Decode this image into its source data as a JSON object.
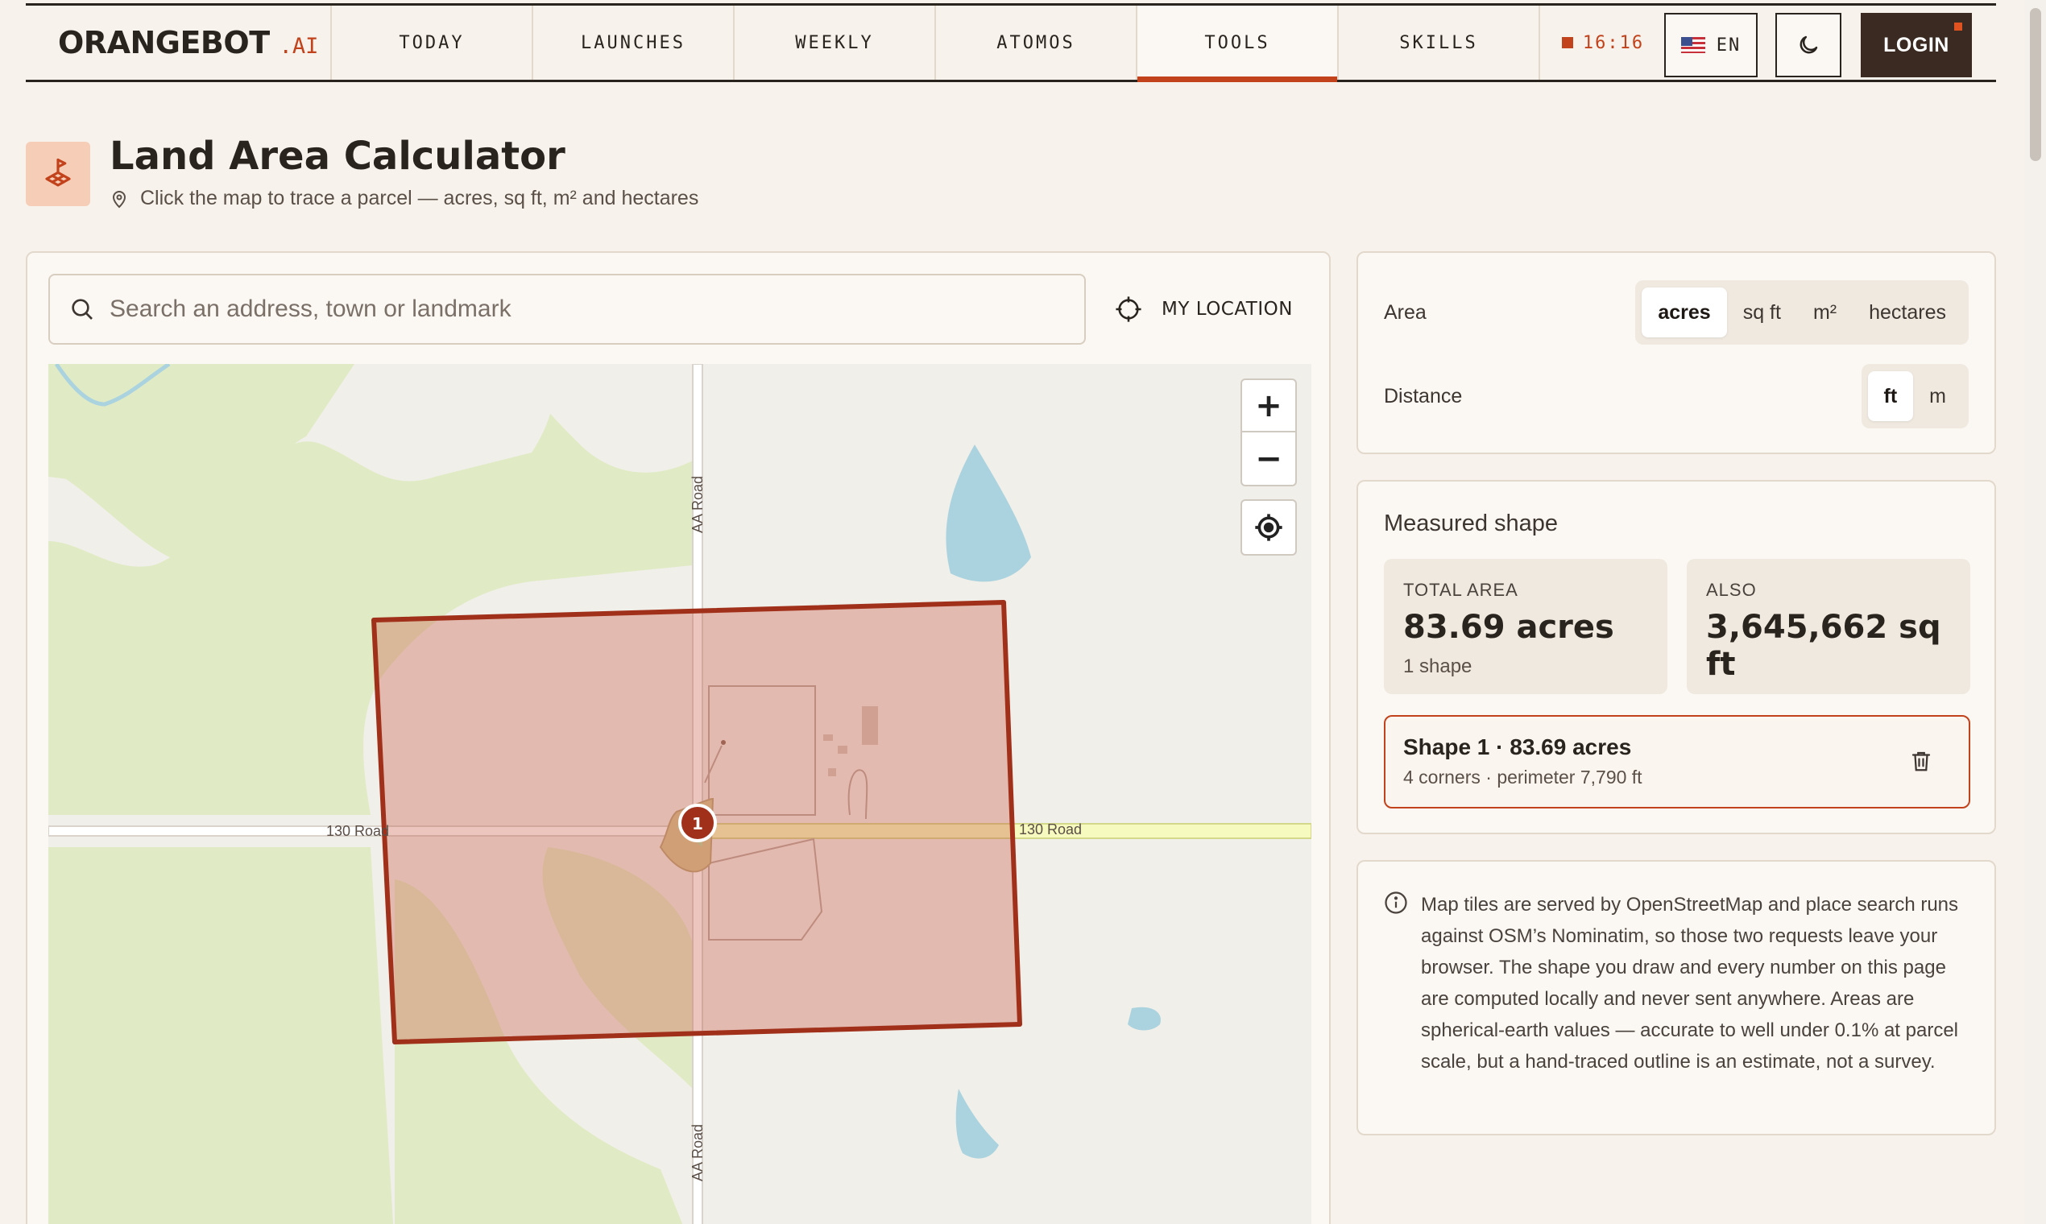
{
  "brand": {
    "name": "ORANGEBOT",
    "suffix": ".AI"
  },
  "nav": {
    "tabs": [
      "TODAY",
      "LAUNCHES",
      "WEEKLY",
      "ATOMOS",
      "TOOLS",
      "SKILLS"
    ],
    "active_tab": "TOOLS",
    "clock": "16:16",
    "language": "EN",
    "login": "LOGIN"
  },
  "header": {
    "title": "Land Area Calculator",
    "subtitle": "Click the map to trace a parcel — acres, sq ft, m² and hectares"
  },
  "search": {
    "placeholder": "Search an address, town or landmark",
    "my_location": "MY LOCATION"
  },
  "map": {
    "road_labels": [
      "AA Road",
      "130 Road",
      "130 Road",
      "AA Road"
    ],
    "vertex_label": "1",
    "zoom_in": "+",
    "zoom_out": "−"
  },
  "units": {
    "area_label": "Area",
    "area_options": [
      "acres",
      "sq ft",
      "m²",
      "hectares"
    ],
    "area_selected": "acres",
    "distance_label": "Distance",
    "distance_options": [
      "ft",
      "m"
    ],
    "distance_selected": "ft"
  },
  "measured": {
    "title": "Measured shape",
    "total_label": "TOTAL AREA",
    "total_value": "83.69 acres",
    "total_sub": "1 shape",
    "also_label": "ALSO",
    "also_value": "3,645,662 sq ft",
    "shape_title": "Shape 1 · 83.69 acres",
    "shape_meta": "4 corners · perimeter 7,790 ft"
  },
  "info": {
    "text": "Map tiles are served by OpenStreetMap and place search runs against OSM’s Nominatim, so those two requests leave your browser. The shape you draw and every number on this page are computed locally and never sent anywhere. Areas are spherical-earth values — accurate to well under 0.1% at parcel scale, but a hand-traced outline is an estimate, not a survey."
  },
  "colors": {
    "accent": "#c2421c",
    "shape_fill": "#d9a9a0",
    "shape_stroke": "#a0301a",
    "water": "#aad3df",
    "park": "#e0ebc6"
  }
}
